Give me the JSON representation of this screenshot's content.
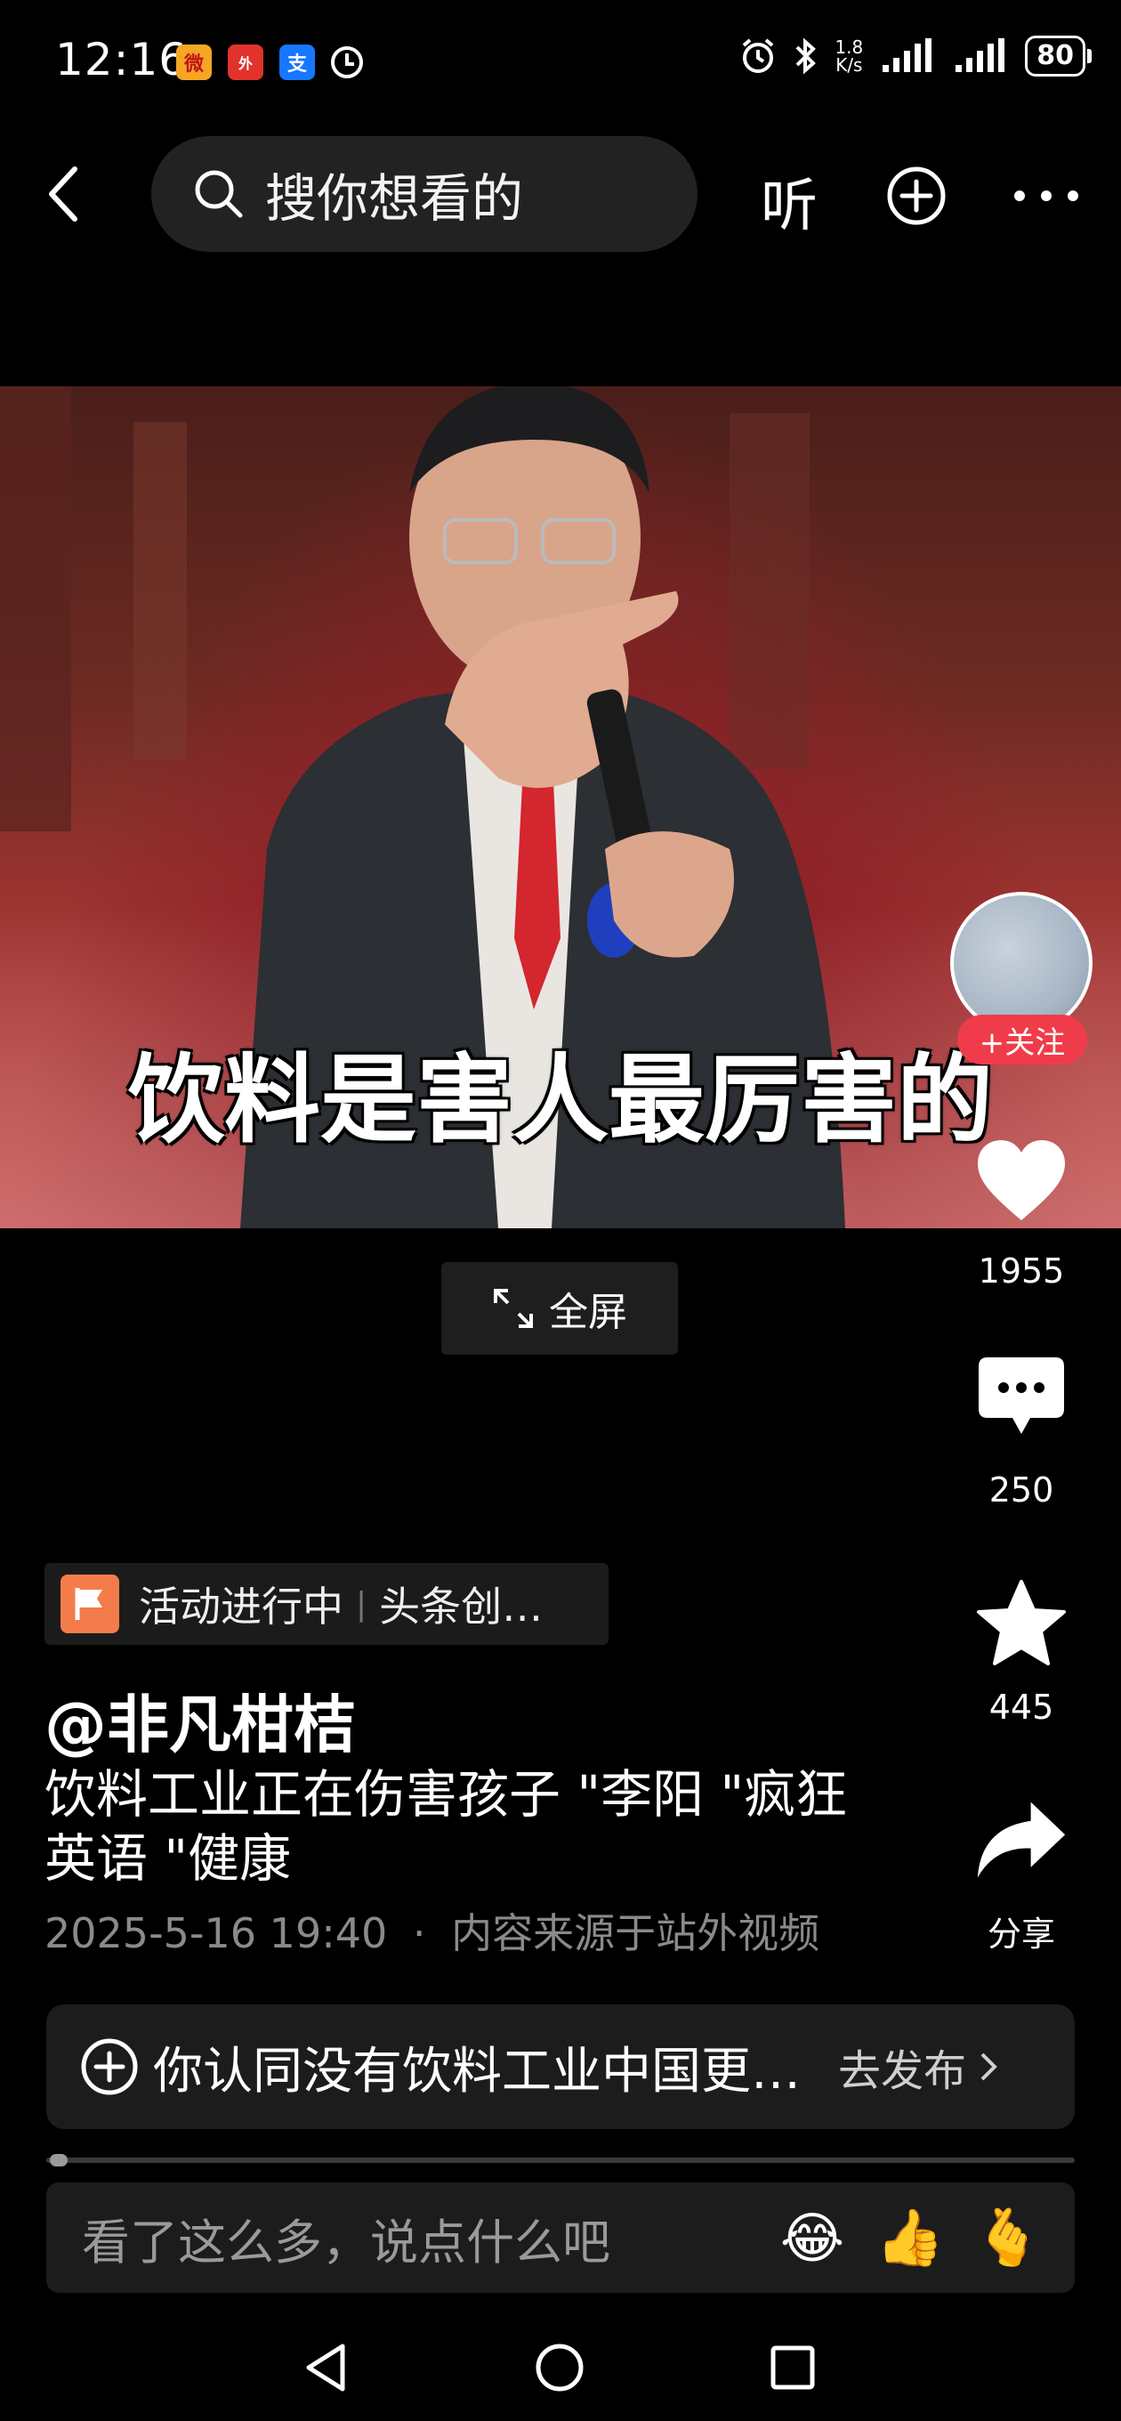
{
  "status_bar": {
    "time": "12:16",
    "net_speed_value": "1.8",
    "net_speed_unit": "K/s",
    "battery": "80"
  },
  "top_nav": {
    "search_placeholder": "搜你想看的",
    "listen_label": "听"
  },
  "video": {
    "subtitle": "饮料是害人最厉害的",
    "fullscreen_label": "全屏"
  },
  "right_rail": {
    "follow_label": "+关注",
    "likes": "1955",
    "comments": "250",
    "favorites": "445",
    "share_label": "分享"
  },
  "info": {
    "activity_status": "活动进行中",
    "activity_name": "头条创…",
    "author": "@非凡柑桔",
    "description": "饮料工业正在伤害孩子 \"李阳 \"疯狂英语 \"健康",
    "timestamp": "2025-5-16 19:40",
    "source": "内容来源于站外视频",
    "dot": "·"
  },
  "topic": {
    "text": "你认同没有饮料工业中国更健康吗",
    "action": "去发布"
  },
  "comment": {
    "placeholder": "看了这么多，说点什么吧",
    "emoji_1": "😂",
    "emoji_2": "👍",
    "emoji_3": "🫰"
  },
  "colors": {
    "background": "#000000",
    "follow_red": "#f03c4a",
    "flag_orange": "#f47c4a",
    "secondary_text": "#8a8a8a"
  }
}
